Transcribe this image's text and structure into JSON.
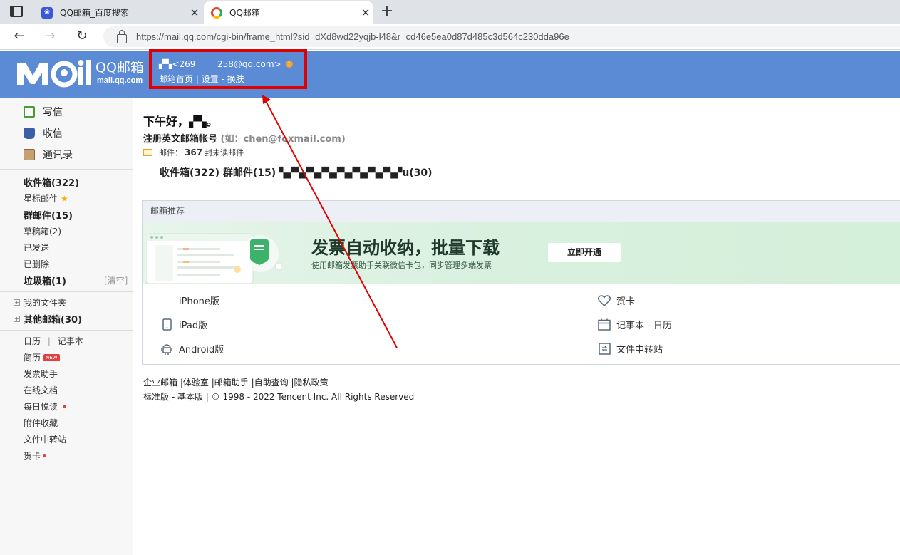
{
  "browser": {
    "tabs": [
      {
        "title": "QQ邮箱_百度搜索",
        "active": false
      },
      {
        "title": "QQ邮箱",
        "active": true
      }
    ],
    "new_tab_glyph": "+",
    "url": "https://mail.qq.com/cgi-bin/frame_html?sid=dXd8wd22yqjb-l48&r=cd46e5ea0d87d485c3d564c230dda96e"
  },
  "header": {
    "logo_text": "M il",
    "logo_cn": "QQ邮箱",
    "logo_domain": "mail.qq.com",
    "user_line": "<269        258@qq.com>",
    "user_name_masked": "▞▚",
    "links": {
      "home": "邮箱首页",
      "sep": "|",
      "settings": "设置",
      "dash": "-",
      "skin": "换肤"
    }
  },
  "sidebar": {
    "quick": [
      {
        "label": "写信",
        "icon": "compose-icon"
      },
      {
        "label": "收信",
        "icon": "inbox-icon"
      },
      {
        "label": "通讯录",
        "icon": "contacts-icon"
      }
    ],
    "folders": {
      "inbox": "收件箱(322)",
      "starred": "星标邮件",
      "group": "群邮件(15)",
      "drafts": "草稿箱(2)",
      "sent": "已发送",
      "deleted": "已删除",
      "spam": "垃圾箱(1)",
      "spam_clear": "[清空]",
      "my_folders": "我的文件夹",
      "other_mail": "其他邮箱(30)"
    },
    "tools": {
      "calendar": "日历",
      "tools_sep": "|",
      "notes": "记事本",
      "resume": "简历",
      "resume_badge": "NEW",
      "invoice": "发票助手",
      "docs": "在线文档",
      "daily": "每日悦读",
      "attachments": "附件收藏",
      "transfer": "文件中转站",
      "cards": "贺卡"
    }
  },
  "main": {
    "greeting": "下午好，▞▚。",
    "register": "注册英文邮箱帐号",
    "register_hint": "(如：chen@foxmail.com)",
    "mail_label": "邮件：",
    "unread_count": "367",
    "unread_suffix": "封未读邮件",
    "folder_summary": "收件箱(322)  群邮件(15)  ▚▞▚▞▚▞▚▞▚▞▚▞▚▞▚▞u(30)",
    "rec_title": "邮箱推荐",
    "banner_title": "发票自动收纳，批量下载",
    "banner_sub": "使用邮箱发票助手关联微信卡包，同步管理多端发票",
    "banner_btn": "立即开通",
    "apps_left": [
      {
        "label": "iPhone版",
        "icon": "apple-icon"
      },
      {
        "label": "iPad版",
        "icon": "ipad-icon"
      },
      {
        "label": "Android版",
        "icon": "android-icon"
      }
    ],
    "apps_right": [
      {
        "label": "贺卡",
        "icon": "heart-icon"
      },
      {
        "label": "记事本 - 日历",
        "icon": "calendar-icon"
      },
      {
        "label": "文件中转站",
        "icon": "transfer-icon"
      }
    ]
  },
  "footer": {
    "links": [
      "企业邮箱",
      "体验室",
      "邮箱助手",
      "自助查询",
      "隐私政策"
    ],
    "line2": "标准版 - 基本版 | © 1998 - 2022 Tencent Inc. All Rights Reserved"
  },
  "colors": {
    "header_bg": "#5b8bd4",
    "highlight_box": "#e00000",
    "arrow": "#e00000"
  }
}
